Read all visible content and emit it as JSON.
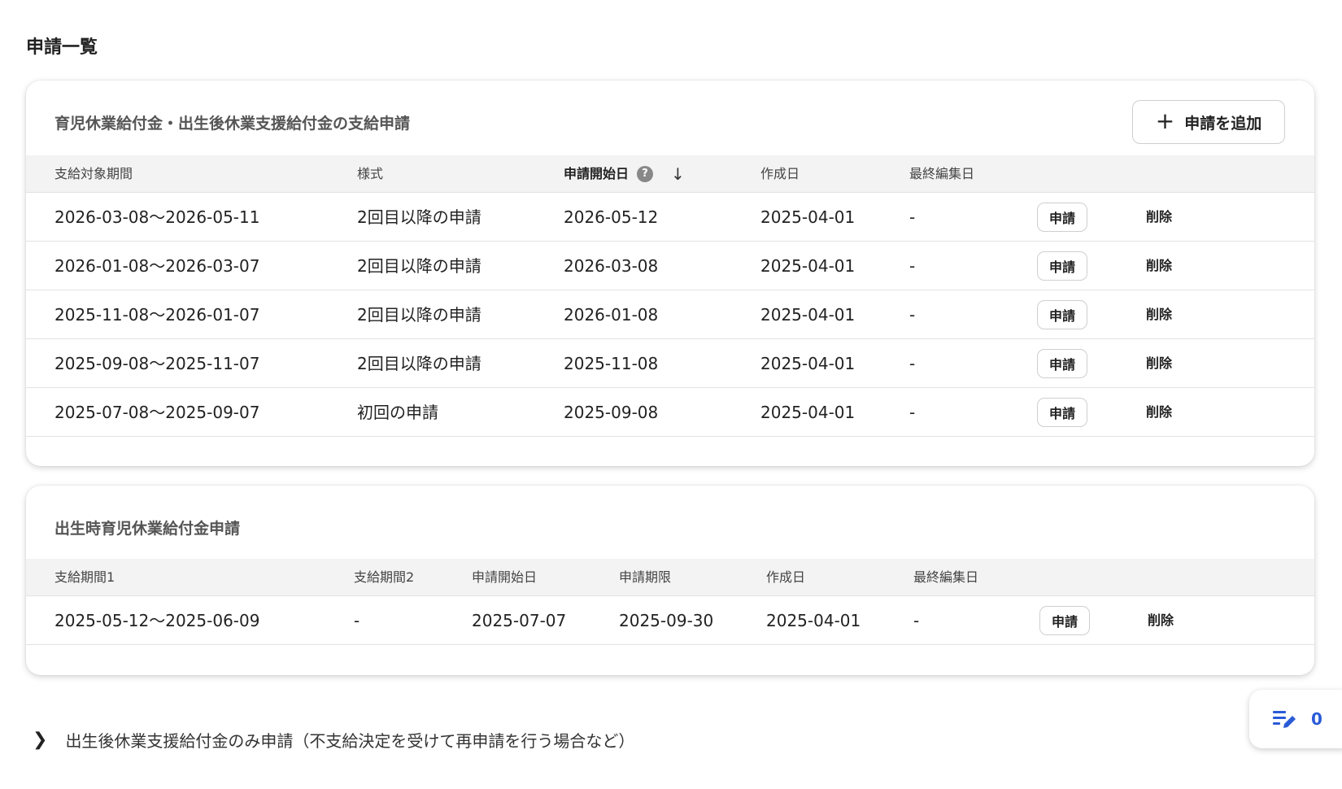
{
  "page_title": "申請一覧",
  "section1": {
    "title": "育児休業給付金・出生後休業支援給付金の支給申請",
    "add_button": {
      "icon": "plus-icon",
      "label": "申請を追加"
    },
    "headers": [
      "支給対象期間",
      "様式",
      "申請開始日",
      "作成日",
      "最終編集日"
    ],
    "sort": {
      "column": "申請開始日",
      "direction": "descending",
      "help_icon_text": "?",
      "sort_icon_text": "↓"
    },
    "rows": [
      {
        "period": "2026-03-08〜2026-05-11",
        "form": "2回目以降の申請",
        "start_date": "2026-05-12",
        "created": "2025-04-01",
        "last_edited": "-",
        "apply": "申請",
        "delete": "削除"
      },
      {
        "period": "2026-01-08〜2026-03-07",
        "form": "2回目以降の申請",
        "start_date": "2026-03-08",
        "created": "2025-04-01",
        "last_edited": "-",
        "apply": "申請",
        "delete": "削除"
      },
      {
        "period": "2025-11-08〜2026-01-07",
        "form": "2回目以降の申請",
        "start_date": "2026-01-08",
        "created": "2025-04-01",
        "last_edited": "-",
        "apply": "申請",
        "delete": "削除"
      },
      {
        "period": "2025-09-08〜2025-11-07",
        "form": "2回目以降の申請",
        "start_date": "2025-11-08",
        "created": "2025-04-01",
        "last_edited": "-",
        "apply": "申請",
        "delete": "削除"
      },
      {
        "period": "2025-07-08〜2025-09-07",
        "form": "初回の申請",
        "start_date": "2025-09-08",
        "created": "2025-04-01",
        "last_edited": "-",
        "apply": "申請",
        "delete": "削除"
      }
    ]
  },
  "section2": {
    "title": "出生時育児休業給付金申請",
    "headers": [
      "支給期間1",
      "支給期間2",
      "申請開始日",
      "申請期限",
      "作成日",
      "最終編集日"
    ],
    "rows": [
      {
        "period1": "2025-05-12〜2025-06-09",
        "period2": "-",
        "start_date": "2025-07-07",
        "deadline": "2025-09-30",
        "created": "2025-04-01",
        "last_edited": "-",
        "apply": "申請",
        "delete": "削除"
      }
    ]
  },
  "collapsed_section": {
    "icon": "chevron-right-icon",
    "label": "出生後休業支援給付金のみ申請（不支給決定を受けて再申請を行う場合など）"
  },
  "fab": {
    "icon": "edit-list-icon",
    "count": "0",
    "color": "#2a5bd7"
  }
}
